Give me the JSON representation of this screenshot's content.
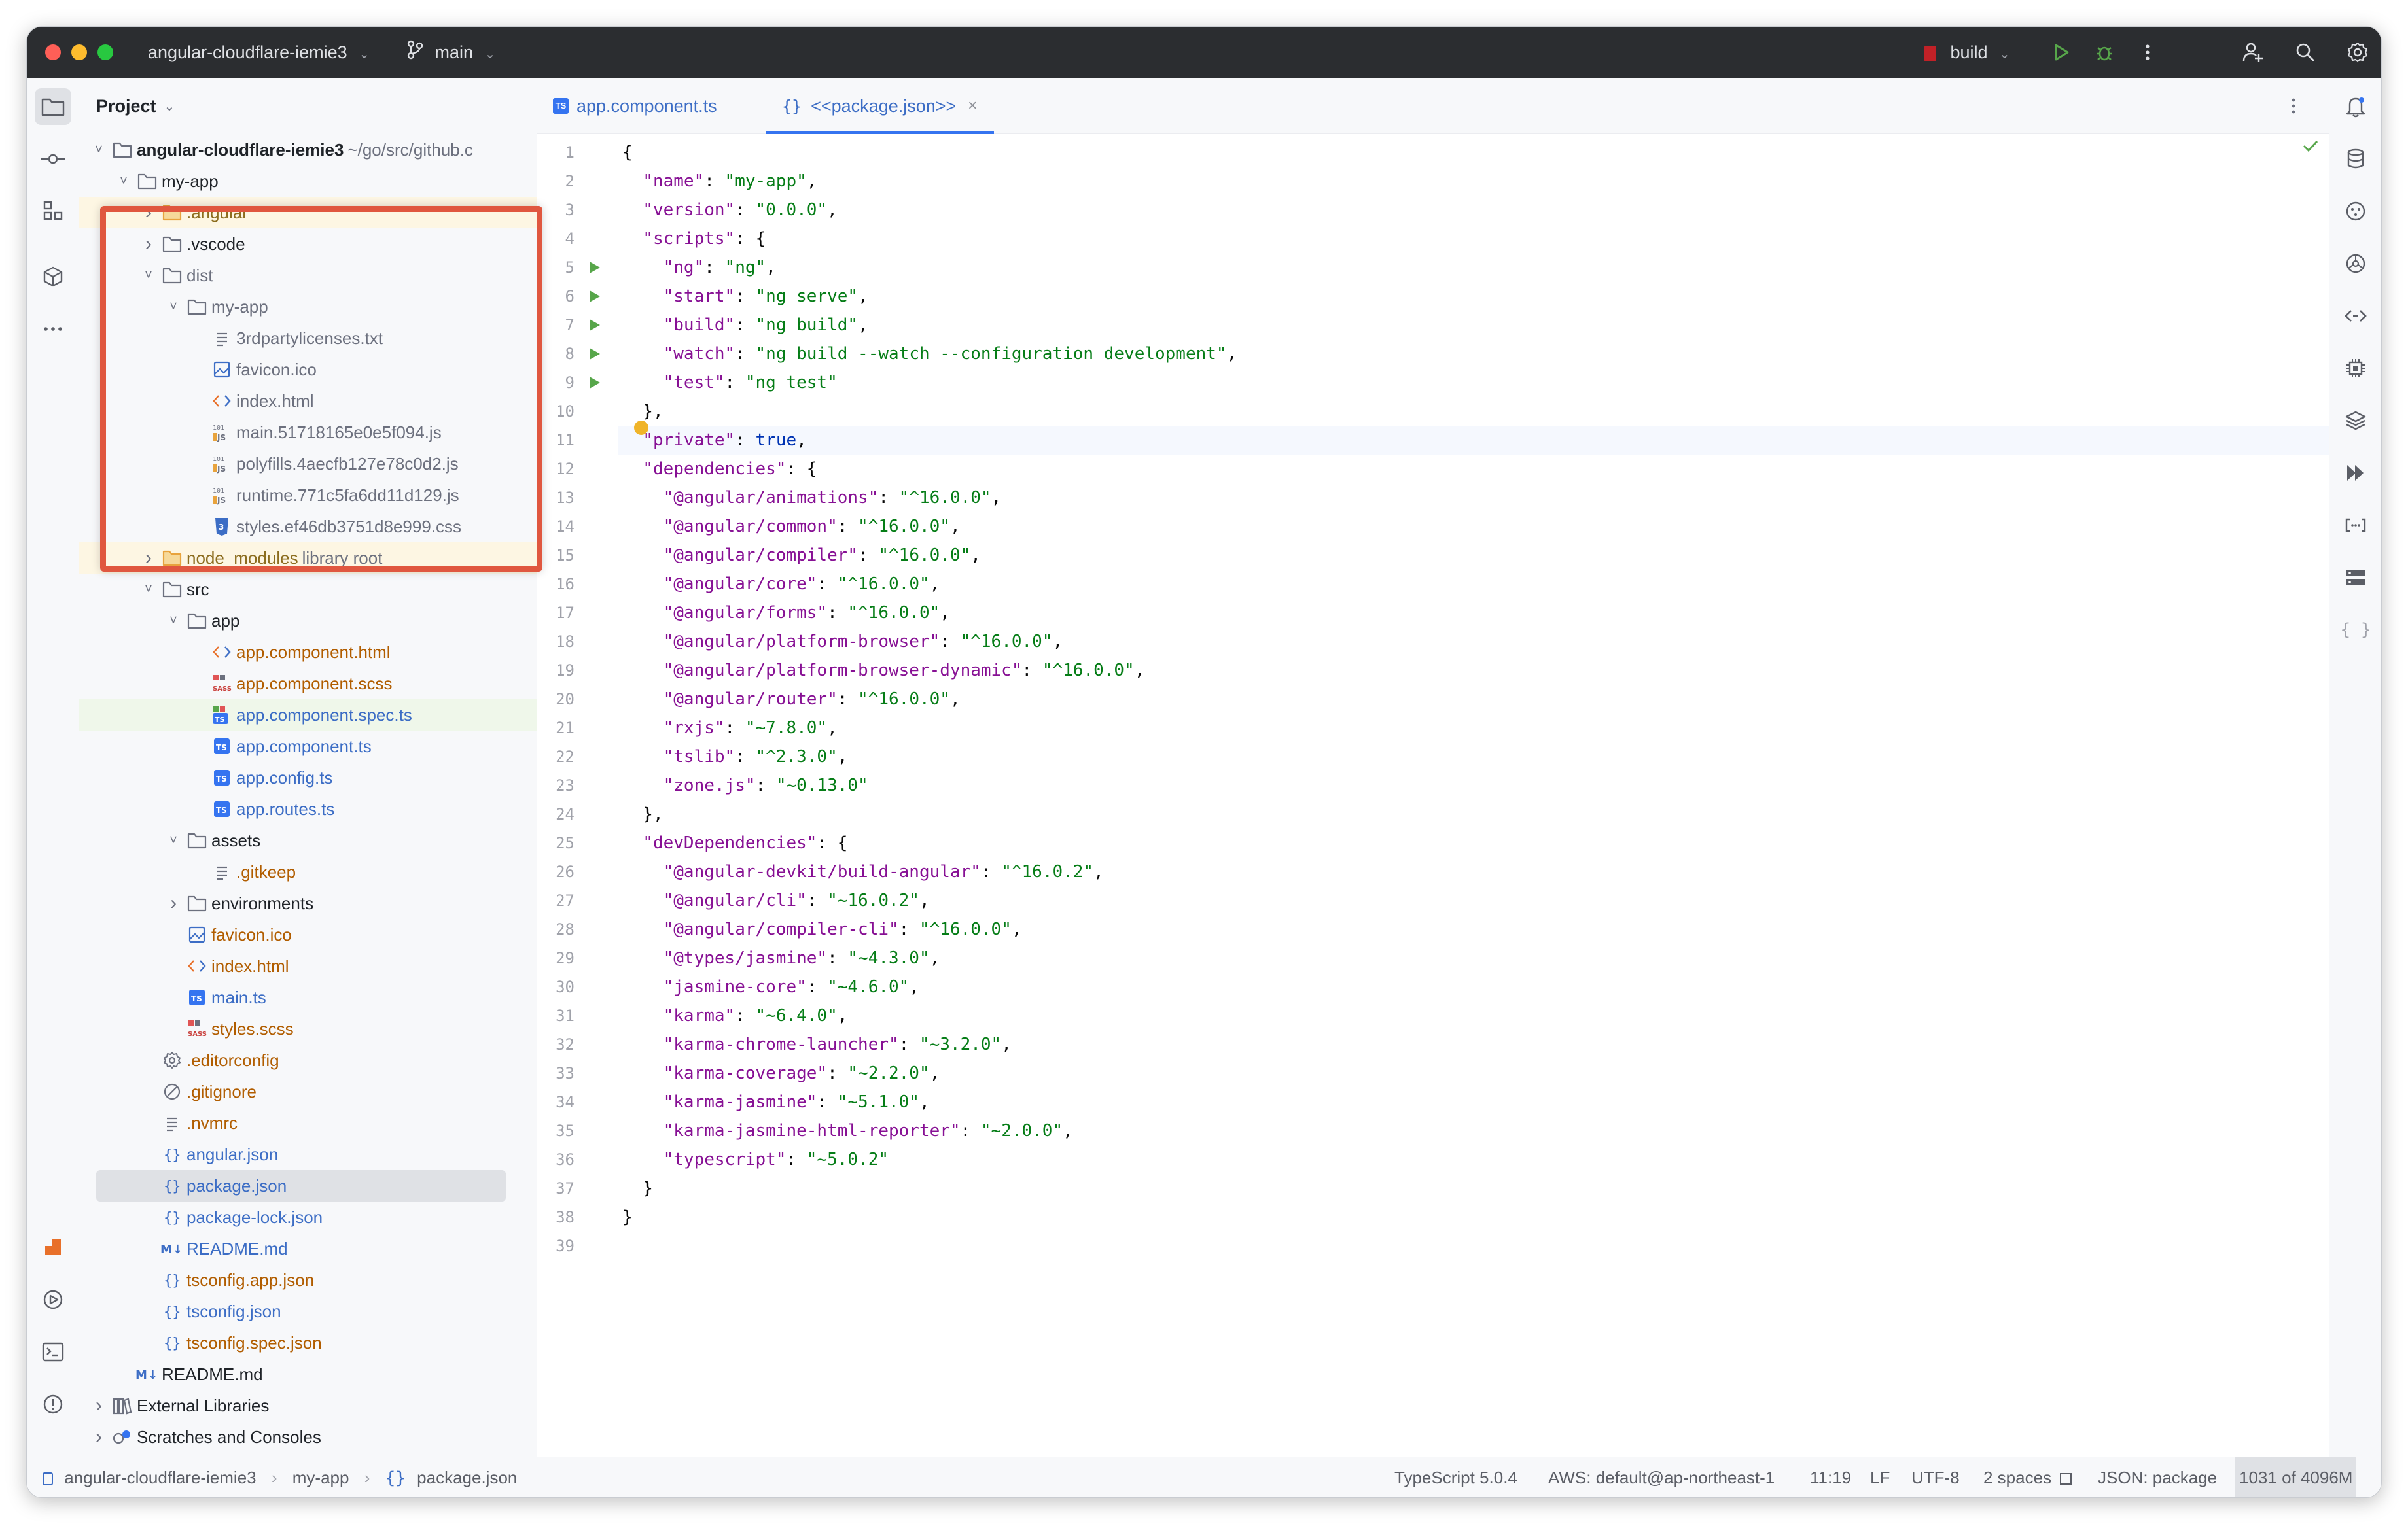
{
  "titlebar": {
    "project_name": "angular-cloudflare-iemie3",
    "branch": "main",
    "run_config": "build"
  },
  "project_panel": {
    "title": "Project",
    "tree": [
      {
        "label": "angular-cloudflare-iemie3",
        "hint": "~/go/src/github.c",
        "depth": 0,
        "expanded": true,
        "icon": "folder-icon",
        "style": "root"
      },
      {
        "label": "my-app",
        "depth": 1,
        "expanded": true,
        "icon": "folder-icon",
        "style": "normal"
      },
      {
        "label": ".angular",
        "depth": 2,
        "expanded": false,
        "icon": "folder-orange-icon",
        "style": "excluded"
      },
      {
        "label": ".vscode",
        "depth": 2,
        "expanded": false,
        "icon": "folder-icon",
        "style": "normal"
      },
      {
        "label": "dist",
        "depth": 2,
        "expanded": true,
        "icon": "folder-icon",
        "style": "ignored"
      },
      {
        "label": "my-app",
        "depth": 3,
        "expanded": true,
        "icon": "folder-icon",
        "style": "ignored"
      },
      {
        "label": "3rdpartylicenses.txt",
        "depth": 4,
        "icon": "text-file-icon",
        "style": "ignored"
      },
      {
        "label": "favicon.ico",
        "depth": 4,
        "icon": "image-file-icon",
        "style": "ignored"
      },
      {
        "label": "index.html",
        "depth": 4,
        "icon": "html-file-icon",
        "style": "ignored"
      },
      {
        "label": "main.51718165e0e5f094.js",
        "depth": 4,
        "icon": "js-file-icon",
        "style": "ignored"
      },
      {
        "label": "polyfills.4aecfb127e78c0d2.js",
        "depth": 4,
        "icon": "js-file-icon",
        "style": "ignored"
      },
      {
        "label": "runtime.771c5fa6dd11d129.js",
        "depth": 4,
        "icon": "js-file-icon",
        "style": "ignored"
      },
      {
        "label": "styles.ef46db3751d8e999.css",
        "depth": 4,
        "icon": "css-file-icon",
        "style": "ignored"
      },
      {
        "label": "node_modules",
        "hint": "library root",
        "depth": 2,
        "expanded": false,
        "icon": "folder-orange-icon",
        "style": "excluded"
      },
      {
        "label": "src",
        "depth": 2,
        "expanded": true,
        "icon": "folder-icon",
        "style": "normal"
      },
      {
        "label": "app",
        "depth": 3,
        "expanded": true,
        "icon": "folder-icon",
        "style": "normal"
      },
      {
        "label": "app.component.html",
        "depth": 4,
        "icon": "html-file-icon",
        "style": "new"
      },
      {
        "label": "app.component.scss",
        "depth": 4,
        "icon": "sass-file-icon",
        "style": "new"
      },
      {
        "label": "app.component.spec.ts",
        "depth": 4,
        "icon": "ts-test-file-icon",
        "style": "modified-bg"
      },
      {
        "label": "app.component.ts",
        "depth": 4,
        "icon": "ts-file-icon",
        "style": "modified"
      },
      {
        "label": "app.config.ts",
        "depth": 4,
        "icon": "ts-file-icon",
        "style": "modified"
      },
      {
        "label": "app.routes.ts",
        "depth": 4,
        "icon": "ts-file-icon",
        "style": "modified"
      },
      {
        "label": "assets",
        "depth": 3,
        "expanded": true,
        "icon": "folder-icon",
        "style": "normal"
      },
      {
        "label": ".gitkeep",
        "depth": 4,
        "icon": "text-file-icon",
        "style": "new"
      },
      {
        "label": "environments",
        "depth": 3,
        "expanded": false,
        "icon": "folder-icon",
        "style": "normal"
      },
      {
        "label": "favicon.ico",
        "depth": 3,
        "icon": "image-file-icon",
        "style": "new"
      },
      {
        "label": "index.html",
        "depth": 3,
        "icon": "html-file-icon",
        "style": "new"
      },
      {
        "label": "main.ts",
        "depth": 3,
        "icon": "ts-file-icon",
        "style": "modified"
      },
      {
        "label": "styles.scss",
        "depth": 3,
        "icon": "sass-file-icon",
        "style": "new"
      },
      {
        "label": ".editorconfig",
        "depth": 2,
        "icon": "gear-file-icon",
        "style": "new"
      },
      {
        "label": ".gitignore",
        "depth": 2,
        "icon": "gitignore-icon",
        "style": "new"
      },
      {
        "label": ".nvmrc",
        "depth": 2,
        "icon": "text-file-icon",
        "style": "new"
      },
      {
        "label": "angular.json",
        "depth": 2,
        "icon": "json-file-icon",
        "style": "modified"
      },
      {
        "label": "package.json",
        "depth": 2,
        "icon": "json-file-icon",
        "style": "selected"
      },
      {
        "label": "package-lock.json",
        "depth": 2,
        "icon": "json-file-icon",
        "style": "modified"
      },
      {
        "label": "README.md",
        "depth": 2,
        "icon": "markdown-file-icon",
        "style": "modified"
      },
      {
        "label": "tsconfig.app.json",
        "depth": 2,
        "icon": "json-file-icon",
        "style": "new"
      },
      {
        "label": "tsconfig.json",
        "depth": 2,
        "icon": "json-file-icon",
        "style": "modified"
      },
      {
        "label": "tsconfig.spec.json",
        "depth": 2,
        "icon": "json-file-icon",
        "style": "new"
      },
      {
        "label": "README.md",
        "depth": 1,
        "icon": "markdown-file-icon",
        "style": "normal"
      },
      {
        "label": "External Libraries",
        "depth": 0,
        "expanded": false,
        "icon": "library-icon",
        "style": "normal"
      },
      {
        "label": "Scratches and Consoles",
        "depth": 0,
        "expanded": false,
        "icon": "scratches-icon",
        "style": "normal"
      }
    ]
  },
  "tabs": [
    {
      "label": "app.component.ts",
      "icon": "ts-file-icon",
      "active": false
    },
    {
      "label": "<<package.json>>",
      "icon": "json-file-icon",
      "active": true
    }
  ],
  "editor": {
    "current_line": 11,
    "run_lines": [
      5,
      6,
      7,
      8,
      9
    ],
    "lines": [
      [
        [
          "p",
          "{"
        ]
      ],
      [
        [
          "p",
          "  "
        ],
        [
          "k",
          "\"name\""
        ],
        [
          "p",
          ": "
        ],
        [
          "s",
          "\"my-app\""
        ],
        [
          "p",
          ","
        ]
      ],
      [
        [
          "p",
          "  "
        ],
        [
          "k",
          "\"version\""
        ],
        [
          "p",
          ": "
        ],
        [
          "s",
          "\"0.0.0\""
        ],
        [
          "p",
          ","
        ]
      ],
      [
        [
          "p",
          "  "
        ],
        [
          "k",
          "\"scripts\""
        ],
        [
          "p",
          ": {"
        ]
      ],
      [
        [
          "p",
          "    "
        ],
        [
          "k",
          "\"ng\""
        ],
        [
          "p",
          ": "
        ],
        [
          "s",
          "\"ng\""
        ],
        [
          "p",
          ","
        ]
      ],
      [
        [
          "p",
          "    "
        ],
        [
          "k",
          "\"start\""
        ],
        [
          "p",
          ": "
        ],
        [
          "s",
          "\"ng serve\""
        ],
        [
          "p",
          ","
        ]
      ],
      [
        [
          "p",
          "    "
        ],
        [
          "k",
          "\"build\""
        ],
        [
          "p",
          ": "
        ],
        [
          "s",
          "\"ng build\""
        ],
        [
          "p",
          ","
        ]
      ],
      [
        [
          "p",
          "    "
        ],
        [
          "k",
          "\"watch\""
        ],
        [
          "p",
          ": "
        ],
        [
          "s",
          "\"ng build --watch --configuration development\""
        ],
        [
          "p",
          ","
        ]
      ],
      [
        [
          "p",
          "    "
        ],
        [
          "k",
          "\"test\""
        ],
        [
          "p",
          ": "
        ],
        [
          "s",
          "\"ng test\""
        ]
      ],
      [
        [
          "p",
          "  },"
        ]
      ],
      [
        [
          "p",
          "  "
        ],
        [
          "k",
          "\"private\""
        ],
        [
          "p",
          ": "
        ],
        [
          "l",
          "true"
        ],
        [
          "p",
          ","
        ]
      ],
      [
        [
          "p",
          "  "
        ],
        [
          "k",
          "\"dependencies\""
        ],
        [
          "p",
          ": {"
        ]
      ],
      [
        [
          "p",
          "    "
        ],
        [
          "k",
          "\"@angular/animations\""
        ],
        [
          "p",
          ": "
        ],
        [
          "s",
          "\"^16.0.0\""
        ],
        [
          "p",
          ","
        ]
      ],
      [
        [
          "p",
          "    "
        ],
        [
          "k",
          "\"@angular/common\""
        ],
        [
          "p",
          ": "
        ],
        [
          "s",
          "\"^16.0.0\""
        ],
        [
          "p",
          ","
        ]
      ],
      [
        [
          "p",
          "    "
        ],
        [
          "k",
          "\"@angular/compiler\""
        ],
        [
          "p",
          ": "
        ],
        [
          "s",
          "\"^16.0.0\""
        ],
        [
          "p",
          ","
        ]
      ],
      [
        [
          "p",
          "    "
        ],
        [
          "k",
          "\"@angular/core\""
        ],
        [
          "p",
          ": "
        ],
        [
          "s",
          "\"^16.0.0\""
        ],
        [
          "p",
          ","
        ]
      ],
      [
        [
          "p",
          "    "
        ],
        [
          "k",
          "\"@angular/forms\""
        ],
        [
          "p",
          ": "
        ],
        [
          "s",
          "\"^16.0.0\""
        ],
        [
          "p",
          ","
        ]
      ],
      [
        [
          "p",
          "    "
        ],
        [
          "k",
          "\"@angular/platform-browser\""
        ],
        [
          "p",
          ": "
        ],
        [
          "s",
          "\"^16.0.0\""
        ],
        [
          "p",
          ","
        ]
      ],
      [
        [
          "p",
          "    "
        ],
        [
          "k",
          "\"@angular/platform-browser-dynamic\""
        ],
        [
          "p",
          ": "
        ],
        [
          "s",
          "\"^16.0.0\""
        ],
        [
          "p",
          ","
        ]
      ],
      [
        [
          "p",
          "    "
        ],
        [
          "k",
          "\"@angular/router\""
        ],
        [
          "p",
          ": "
        ],
        [
          "s",
          "\"^16.0.0\""
        ],
        [
          "p",
          ","
        ]
      ],
      [
        [
          "p",
          "    "
        ],
        [
          "k",
          "\"rxjs\""
        ],
        [
          "p",
          ": "
        ],
        [
          "s",
          "\"~7.8.0\""
        ],
        [
          "p",
          ","
        ]
      ],
      [
        [
          "p",
          "    "
        ],
        [
          "k",
          "\"tslib\""
        ],
        [
          "p",
          ": "
        ],
        [
          "s",
          "\"^2.3.0\""
        ],
        [
          "p",
          ","
        ]
      ],
      [
        [
          "p",
          "    "
        ],
        [
          "k",
          "\"zone.js\""
        ],
        [
          "p",
          ": "
        ],
        [
          "s",
          "\"~0.13.0\""
        ]
      ],
      [
        [
          "p",
          "  },"
        ]
      ],
      [
        [
          "p",
          "  "
        ],
        [
          "k",
          "\"devDependencies\""
        ],
        [
          "p",
          ": {"
        ]
      ],
      [
        [
          "p",
          "    "
        ],
        [
          "k",
          "\"@angular-devkit/build-angular\""
        ],
        [
          "p",
          ": "
        ],
        [
          "s",
          "\"^16.0.2\""
        ],
        [
          "p",
          ","
        ]
      ],
      [
        [
          "p",
          "    "
        ],
        [
          "k",
          "\"@angular/cli\""
        ],
        [
          "p",
          ": "
        ],
        [
          "s",
          "\"~16.0.2\""
        ],
        [
          "p",
          ","
        ]
      ],
      [
        [
          "p",
          "    "
        ],
        [
          "k",
          "\"@angular/compiler-cli\""
        ],
        [
          "p",
          ": "
        ],
        [
          "s",
          "\"^16.0.0\""
        ],
        [
          "p",
          ","
        ]
      ],
      [
        [
          "p",
          "    "
        ],
        [
          "k",
          "\"@types/jasmine\""
        ],
        [
          "p",
          ": "
        ],
        [
          "s",
          "\"~4.3.0\""
        ],
        [
          "p",
          ","
        ]
      ],
      [
        [
          "p",
          "    "
        ],
        [
          "k",
          "\"jasmine-core\""
        ],
        [
          "p",
          ": "
        ],
        [
          "s",
          "\"~4.6.0\""
        ],
        [
          "p",
          ","
        ]
      ],
      [
        [
          "p",
          "    "
        ],
        [
          "k",
          "\"karma\""
        ],
        [
          "p",
          ": "
        ],
        [
          "s",
          "\"~6.4.0\""
        ],
        [
          "p",
          ","
        ]
      ],
      [
        [
          "p",
          "    "
        ],
        [
          "k",
          "\"karma-chrome-launcher\""
        ],
        [
          "p",
          ": "
        ],
        [
          "s",
          "\"~3.2.0\""
        ],
        [
          "p",
          ","
        ]
      ],
      [
        [
          "p",
          "    "
        ],
        [
          "k",
          "\"karma-coverage\""
        ],
        [
          "p",
          ": "
        ],
        [
          "s",
          "\"~2.2.0\""
        ],
        [
          "p",
          ","
        ]
      ],
      [
        [
          "p",
          "    "
        ],
        [
          "k",
          "\"karma-jasmine\""
        ],
        [
          "p",
          ": "
        ],
        [
          "s",
          "\"~5.1.0\""
        ],
        [
          "p",
          ","
        ]
      ],
      [
        [
          "p",
          "    "
        ],
        [
          "k",
          "\"karma-jasmine-html-reporter\""
        ],
        [
          "p",
          ": "
        ],
        [
          "s",
          "\"~2.0.0\""
        ],
        [
          "p",
          ","
        ]
      ],
      [
        [
          "p",
          "    "
        ],
        [
          "k",
          "\"typescript\""
        ],
        [
          "p",
          ": "
        ],
        [
          "s",
          "\"~5.0.2\""
        ]
      ],
      [
        [
          "p",
          "  }"
        ]
      ],
      [
        [
          "p",
          "}"
        ]
      ],
      [
        [
          "p",
          ""
        ]
      ]
    ]
  },
  "statusbar": {
    "breadcrumb": [
      "angular-cloudflare-iemie3",
      "my-app",
      "package.json"
    ],
    "language": "TypeScript 5.0.4",
    "aws": "AWS: default@ap-northeast-1",
    "position": "11:19",
    "line_sep": "LF",
    "encoding": "UTF-8",
    "indent": "2 spaces",
    "schema": "JSON: package",
    "memory": "1031 of 4096M"
  },
  "colors": {
    "titlebar_bg": "#2b2d30",
    "accent": "#3574f0",
    "highlight_box": "#e0573f",
    "folder_orange": "#e8a33d"
  }
}
